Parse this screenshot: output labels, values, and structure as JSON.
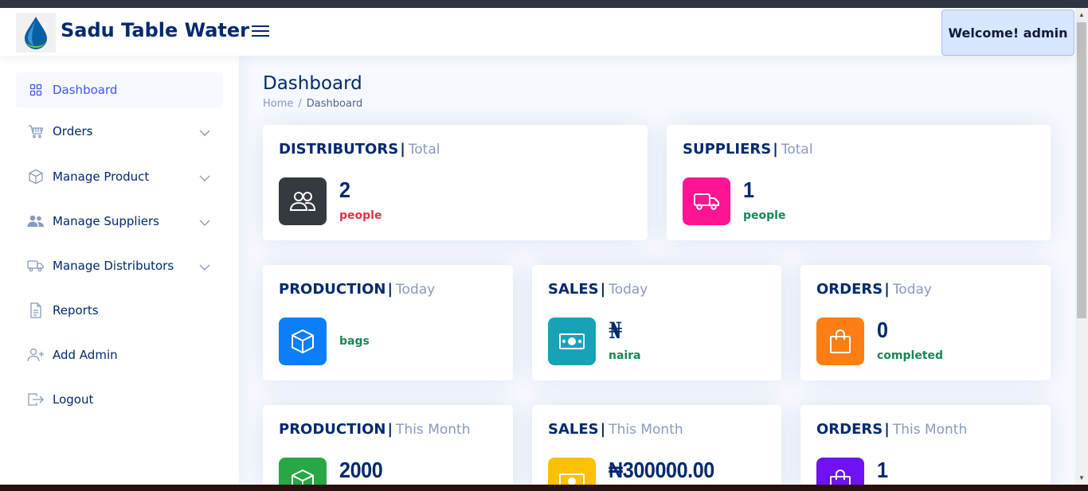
{
  "header": {
    "brand": "Sadu Table Water",
    "welcome": "Welcome! admin"
  },
  "sidebar": {
    "items": [
      {
        "label": "Dashboard",
        "icon": "grid-icon"
      },
      {
        "label": "Orders",
        "icon": "cart-icon"
      },
      {
        "label": "Manage Product",
        "icon": "box-icon"
      },
      {
        "label": "Manage Suppliers",
        "icon": "people-icon"
      },
      {
        "label": "Manage Distributors",
        "icon": "truck-icon"
      },
      {
        "label": "Reports",
        "icon": "document-icon"
      },
      {
        "label": "Add Admin",
        "icon": "person-plus-icon"
      },
      {
        "label": "Logout",
        "icon": "logout-icon"
      }
    ]
  },
  "page": {
    "title": "Dashboard",
    "breadcrumb": [
      "Home",
      "Dashboard"
    ]
  },
  "cards": {
    "distributors": {
      "title": "DISTRIBUTORS",
      "period": "Total",
      "value": "2",
      "unit": "people"
    },
    "suppliers": {
      "title": "SUPPLIERS",
      "period": "Total",
      "value": "1",
      "unit": "people"
    },
    "production_today": {
      "title": "PRODUCTION",
      "period": "Today",
      "value": "",
      "unit": "bags"
    },
    "sales_today": {
      "title": "SALES",
      "period": "Today",
      "value": "₦",
      "unit": "naira"
    },
    "orders_today": {
      "title": "ORDERS",
      "period": "Today",
      "value": "0",
      "unit": "completed"
    },
    "production_month": {
      "title": "PRODUCTION",
      "period": "This Month",
      "value": "2000",
      "unit": ""
    },
    "sales_month": {
      "title": "SALES",
      "period": "This Month",
      "value": "₦300000.00",
      "unit": ""
    },
    "orders_month": {
      "title": "ORDERS",
      "period": "This Month",
      "value": "1",
      "unit": ""
    }
  },
  "colors": {
    "distributors": "#343a40",
    "suppliers": "#ff1493",
    "production": "#0d7ef9",
    "sales": "#17a2b8",
    "orders": "#fd7e14",
    "production_month": "#28a745",
    "sales_month": "#ffc107",
    "orders_month": "#6f12f5"
  }
}
